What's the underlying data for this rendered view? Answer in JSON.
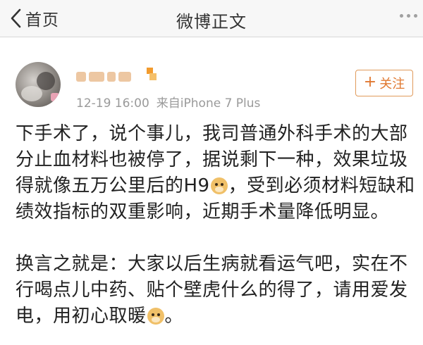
{
  "nav": {
    "back_label": "首页",
    "title": "微博正文"
  },
  "post": {
    "timestamp": "12-19 16:00",
    "source": "来自iPhone 7 Plus",
    "follow_label": "关注",
    "follow_icon": "plus",
    "paragraph1_part1": "下手术了，说个事儿，我司普通外科手术的大部分止血材料也被停了，据说剩下一种，效果垃圾得就像五万公里后的H9",
    "paragraph1_part2": "，受到必须材料短缺和绩效指标的双重影响，近期手术量降低明显。",
    "paragraph2_part1": "换言之就是：大家以后生病就看运气吧，实在不行喝点儿中药、贴个壁虎什么的得了，请用爱发电，用初心取暖",
    "paragraph2_part2": "。",
    "emoji_name": "doge-emoji"
  },
  "colors": {
    "accent": "#e07830",
    "follow_border": "#e09a5b",
    "meta_text": "#9a9a9a"
  }
}
